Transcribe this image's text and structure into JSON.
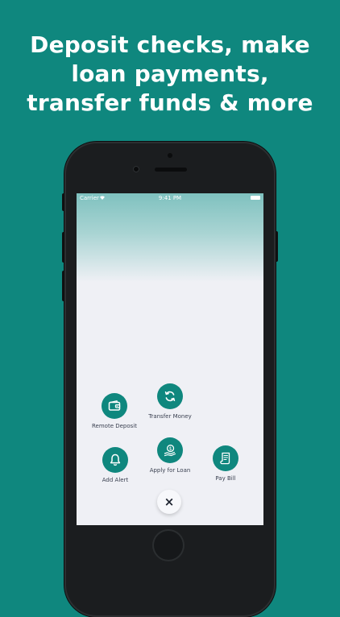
{
  "headline": {
    "line1": "Deposit checks, make",
    "line2": "loan payments,",
    "line3": "transfer funds & more"
  },
  "status_bar": {
    "carrier": "Carrier",
    "time": "9:41 PM"
  },
  "actions": {
    "remote_deposit": {
      "label": "Remote Deposit",
      "icon": "wallet-icon"
    },
    "transfer_money": {
      "label": "Transfer Money",
      "icon": "refresh-icon"
    },
    "add_alert": {
      "label": "Add Alert",
      "icon": "bell-icon"
    },
    "apply_for_loan": {
      "label": "Apply for Loan",
      "icon": "money-hand-icon"
    },
    "pay_bill": {
      "label": "Pay Bill",
      "icon": "receipt-icon"
    }
  },
  "close_button": {
    "glyph": "×"
  },
  "colors": {
    "background": "#0f877e",
    "accent": "#0f877e",
    "screen": "#eff0f5",
    "label": "#3b4151"
  }
}
